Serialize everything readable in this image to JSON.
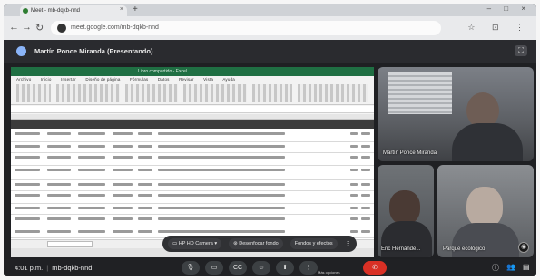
{
  "browser": {
    "tab_title": "Meet - mb-dqkb-nnd",
    "tab_close": "×",
    "new_tab": "+",
    "window_controls": "– □ ×",
    "nav_back": "←",
    "nav_forward": "→",
    "nav_reload": "↻",
    "url": "meet.google.com/mb-dqkb-nnd",
    "nav_right_icons": "☆ ⊡ ⋮"
  },
  "meet": {
    "presenting_title": "Martín Ponce Miranda (Presentando)",
    "presenting_right": "⛶"
  },
  "shared_screen": {
    "excel_title": "Libro compartido - Excel",
    "ribbon_tabs": [
      "Archivo",
      "Inicio",
      "Insertar",
      "Diseño de página",
      "Fórmulas",
      "Datos",
      "Revisar",
      "Vista",
      "Ayuda"
    ]
  },
  "participants": [
    {
      "name": "Martín Ponce Miranda"
    },
    {
      "name": "Eric Hernánde..."
    },
    {
      "name": "Parque ecológico"
    }
  ],
  "float_bar": {
    "camera_label": "HP HD Camera",
    "blur_label": "Desenfocar fondo",
    "effects_label": "Fondos y efectos",
    "camera_icon": "▭",
    "chevron": "▾",
    "blur_icon": "⊛",
    "more_icon": "⋮"
  },
  "controls": {
    "time": "4:01 p.m.",
    "separator": "|",
    "meeting_code": "mb-dqkb-nnd",
    "more_options_label": "Más opciones",
    "buttons": {
      "mic": "🎙",
      "camera": "▭",
      "captions": "CC",
      "emoji": "☺",
      "present": "⬆",
      "more": "⋮",
      "hangup": "✆"
    },
    "right": {
      "info": "ⓘ",
      "people": "👥",
      "chat": "▤"
    }
  }
}
